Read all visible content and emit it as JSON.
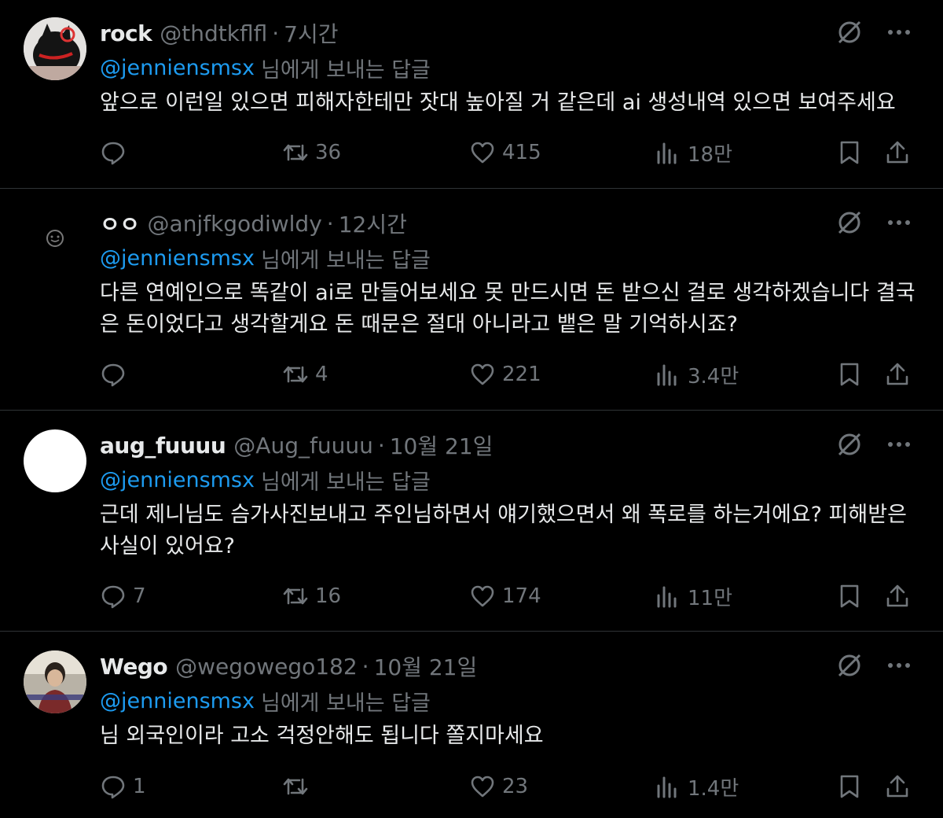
{
  "tweets": [
    {
      "name": "rock",
      "handle": "@thdtkflfl",
      "time": "7시간",
      "reply_mention": "@jenniensmsx",
      "reply_suffix": "님에게 보내는 답글",
      "text": "앞으로 이런일 있으면 피해자한테만 잣대 높아질 거 같은데 ai 생성내역 있으면 보여주세요",
      "replies": "",
      "retweets": "36",
      "likes": "415",
      "views": "18만"
    },
    {
      "name": "ㅇㅇ",
      "handle": "@anjfkgodiwldy",
      "time": "12시간",
      "reply_mention": "@jenniensmsx",
      "reply_suffix": "님에게 보내는 답글",
      "text": "다른 연예인으로 똑같이 ai로 만들어보세요 못 만드시면 돈 받으신 걸로 생각하겠습니다 결국은 돈이었다고 생각할게요 돈 때문은 절대 아니라고 뱉은 말 기억하시죠?",
      "replies": "",
      "retweets": "4",
      "likes": "221",
      "views": "3.4만"
    },
    {
      "name": "aug_fuuuu",
      "handle": "@Aug_fuuuu",
      "time": "10월 21일",
      "reply_mention": "@jenniensmsx",
      "reply_suffix": "님에게 보내는 답글",
      "text": "근데 제니님도 슴가사진보내고 주인님하면서 얘기했으면서 왜 폭로를 하는거에요? 피해받은 사실이 있어요?",
      "replies": "7",
      "retweets": "16",
      "likes": "174",
      "views": "11만"
    },
    {
      "name": "Wego",
      "handle": "@wegowego182",
      "time": "10월 21일",
      "reply_mention": "@jenniensmsx",
      "reply_suffix": "님에게 보내는 답글",
      "text": "님 외국인이라 고소 걱정안해도 됩니다 쫄지마세요",
      "replies": "1",
      "retweets": "",
      "likes": "23",
      "views": "1.4만"
    }
  ],
  "separator": "·",
  "icons": {
    "grok": "grok-icon",
    "more": "more-icon",
    "reply": "reply-icon",
    "retweet": "retweet-icon",
    "like": "like-icon",
    "views": "views-icon",
    "bookmark": "bookmark-icon",
    "share": "share-icon"
  },
  "colors": {
    "background": "#000000",
    "text": "#e7e9ea",
    "muted": "#71767b",
    "accent": "#1d9bf0",
    "divider": "#2f3336"
  }
}
